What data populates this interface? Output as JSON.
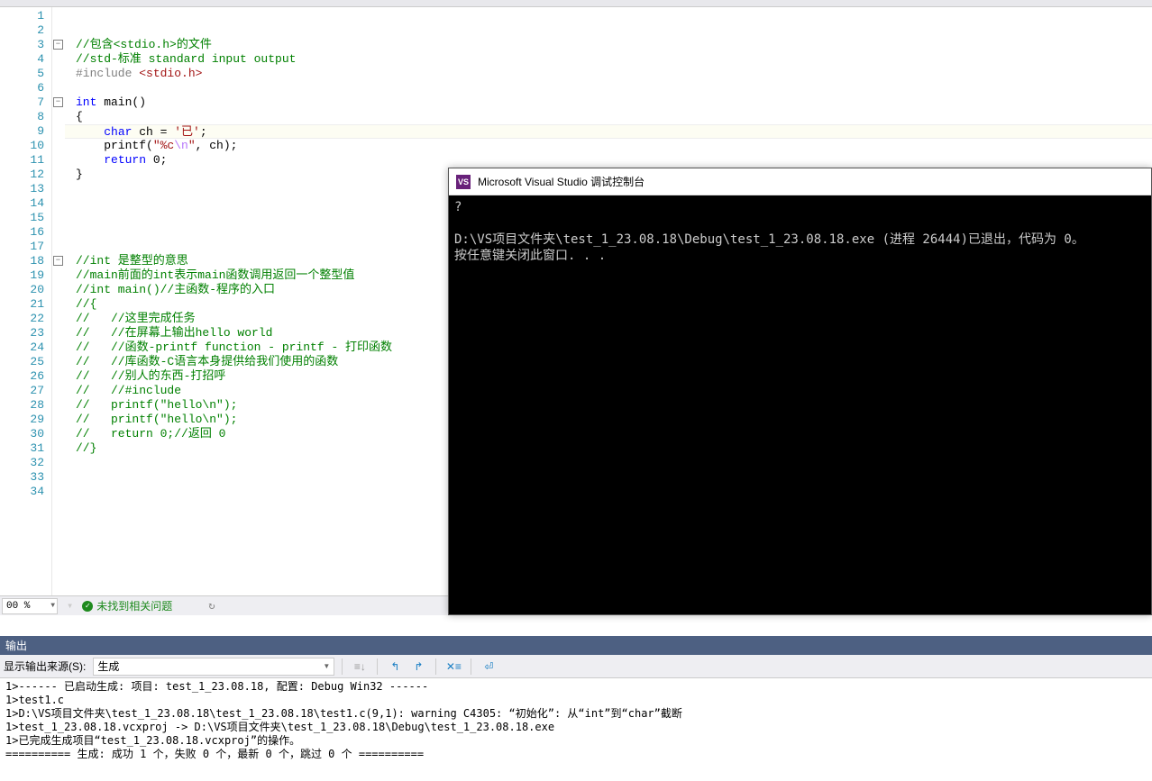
{
  "editor": {
    "zoom": "00 %",
    "status_text": "未找到相关问题",
    "line_numbers": [
      "1",
      "2",
      "3",
      "4",
      "5",
      "6",
      "7",
      "8",
      "9",
      "10",
      "11",
      "12",
      "13",
      "14",
      "15",
      "16",
      "17",
      "18",
      "19",
      "20",
      "21",
      "22",
      "23",
      "24",
      "25",
      "26",
      "27",
      "28",
      "29",
      "30",
      "31",
      "32",
      "33",
      "34"
    ],
    "code_lines": [
      {
        "n": 1,
        "tokens": []
      },
      {
        "n": 2,
        "tokens": []
      },
      {
        "n": 3,
        "fold": true,
        "tokens": [
          {
            "t": "//包含<stdio.h>的文件",
            "c": "c-comment"
          }
        ]
      },
      {
        "n": 4,
        "tokens": [
          {
            "t": "//std-标准 standard input output",
            "c": "c-comment"
          }
        ]
      },
      {
        "n": 5,
        "tokens": [
          {
            "t": "#include ",
            "c": "c-preproc"
          },
          {
            "t": "<stdio.h>",
            "c": "c-include"
          }
        ]
      },
      {
        "n": 6,
        "tokens": []
      },
      {
        "n": 7,
        "fold": true,
        "tokens": [
          {
            "t": "int",
            "c": "c-type"
          },
          {
            "t": " main()",
            "c": "c-punc"
          }
        ]
      },
      {
        "n": 8,
        "tokens": [
          {
            "t": "{",
            "c": "c-punc"
          }
        ]
      },
      {
        "n": 9,
        "hl": true,
        "tokens": [
          {
            "t": "    ",
            "c": ""
          },
          {
            "t": "char",
            "c": "c-type"
          },
          {
            "t": " ch = ",
            "c": "c-punc"
          },
          {
            "t": "'已'",
            "c": "c-string"
          },
          {
            "t": ";",
            "c": "c-punc"
          }
        ]
      },
      {
        "n": 10,
        "tokens": [
          {
            "t": "    printf(",
            "c": "c-punc"
          },
          {
            "t": "\"%c",
            "c": "c-string"
          },
          {
            "t": "\\n",
            "c": "c-escape"
          },
          {
            "t": "\"",
            "c": "c-string"
          },
          {
            "t": ", ch);",
            "c": "c-punc"
          }
        ]
      },
      {
        "n": 11,
        "tokens": [
          {
            "t": "    ",
            "c": ""
          },
          {
            "t": "return",
            "c": "c-keyword"
          },
          {
            "t": " 0;",
            "c": "c-punc"
          }
        ]
      },
      {
        "n": 12,
        "tokens": [
          {
            "t": "}",
            "c": "c-punc"
          }
        ]
      },
      {
        "n": 13,
        "tokens": []
      },
      {
        "n": 14,
        "tokens": []
      },
      {
        "n": 15,
        "tokens": []
      },
      {
        "n": 16,
        "tokens": []
      },
      {
        "n": 17,
        "tokens": []
      },
      {
        "n": 18,
        "fold": true,
        "tokens": [
          {
            "t": "//int 是整型的意思",
            "c": "c-comment"
          }
        ]
      },
      {
        "n": 19,
        "tokens": [
          {
            "t": "//main前面的int表示main函数调用返回一个整型值",
            "c": "c-comment"
          }
        ]
      },
      {
        "n": 20,
        "tokens": [
          {
            "t": "//int main()//主函数-程序的入口",
            "c": "c-comment"
          }
        ]
      },
      {
        "n": 21,
        "tokens": [
          {
            "t": "//{",
            "c": "c-comment"
          }
        ]
      },
      {
        "n": 22,
        "tokens": [
          {
            "t": "//   //这里完成任务",
            "c": "c-comment"
          }
        ]
      },
      {
        "n": 23,
        "tokens": [
          {
            "t": "//   //在屏幕上输出hello world",
            "c": "c-comment"
          }
        ]
      },
      {
        "n": 24,
        "tokens": [
          {
            "t": "//   //函数-printf function - printf - 打印函数",
            "c": "c-comment"
          }
        ]
      },
      {
        "n": 25,
        "tokens": [
          {
            "t": "//   //库函数-C语言本身提供给我们使用的函数",
            "c": "c-comment"
          }
        ]
      },
      {
        "n": 26,
        "tokens": [
          {
            "t": "//   //别人的东西-打招呼",
            "c": "c-comment"
          }
        ]
      },
      {
        "n": 27,
        "tokens": [
          {
            "t": "//   //#include",
            "c": "c-comment"
          }
        ]
      },
      {
        "n": 28,
        "tokens": [
          {
            "t": "//   printf(\"hello\\n\");",
            "c": "c-comment"
          }
        ]
      },
      {
        "n": 29,
        "tokens": [
          {
            "t": "//   printf(\"hello\\n\");",
            "c": "c-comment"
          }
        ]
      },
      {
        "n": 30,
        "tokens": [
          {
            "t": "//   return 0;//返回 0",
            "c": "c-comment"
          }
        ]
      },
      {
        "n": 31,
        "tokens": [
          {
            "t": "//}",
            "c": "c-comment"
          }
        ]
      },
      {
        "n": 32,
        "tokens": []
      },
      {
        "n": 33,
        "tokens": []
      },
      {
        "n": 34,
        "tokens": []
      }
    ]
  },
  "console": {
    "title": "Microsoft Visual Studio 调试控制台",
    "lines": [
      "?",
      "",
      "D:\\VS项目文件夹\\test_1_23.08.18\\Debug\\test_1_23.08.18.exe (进程 26444)已退出，代码为 0。",
      "按任意键关闭此窗口. . ."
    ]
  },
  "output": {
    "panel_title": "输出",
    "source_label": "显示输出来源(S):",
    "source_value": "生成",
    "lines": [
      "1>------ 已启动生成: 项目: test_1_23.08.18, 配置: Debug Win32 ------",
      "1>test1.c",
      "1>D:\\VS项目文件夹\\test_1_23.08.18\\test_1_23.08.18\\test1.c(9,1): warning C4305: “初始化”: 从“int”到“char”截断",
      "1>test_1_23.08.18.vcxproj -> D:\\VS项目文件夹\\test_1_23.08.18\\Debug\\test_1_23.08.18.exe",
      "1>已完成生成项目“test_1_23.08.18.vcxproj”的操作。",
      "========== 生成: 成功 1 个，失败 0 个，最新 0 个，跳过 0 个 =========="
    ]
  }
}
